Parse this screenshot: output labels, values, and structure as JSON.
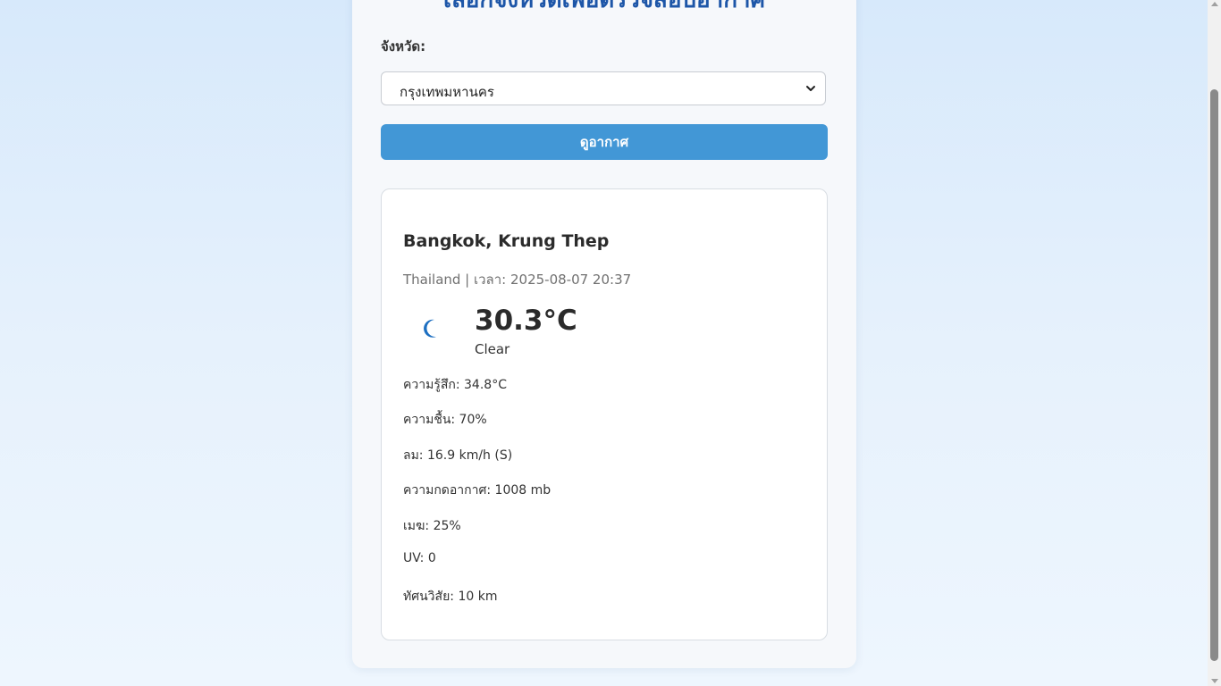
{
  "header": {
    "title": "เลือกจังหวัดเพื่อตรวจสอบอากาศ"
  },
  "form": {
    "province_label": "จังหวัด:",
    "province_selected": "กรุงเทพมหานคร",
    "submit_label": "ดูอากาศ"
  },
  "weather": {
    "location": "Bangkok, Krung Thep",
    "meta": "Thailand | เวลา: 2025-08-07 20:37",
    "icon": "moon-icon",
    "temperature": "30.3°C",
    "condition": "Clear",
    "details": [
      "ความรู้สึก: 34.8°C",
      "ความชื้น: 70%",
      "ลม: 16.9 km/h (S)",
      "ความกดอากาศ: 1008 mb",
      "เมฆ: 25%",
      "UV: 0",
      "ทัศนวิสัย: 10 km"
    ]
  },
  "colors": {
    "accent": "#4297d6",
    "title": "#1d56a8",
    "icon": "#1d6fc1"
  }
}
